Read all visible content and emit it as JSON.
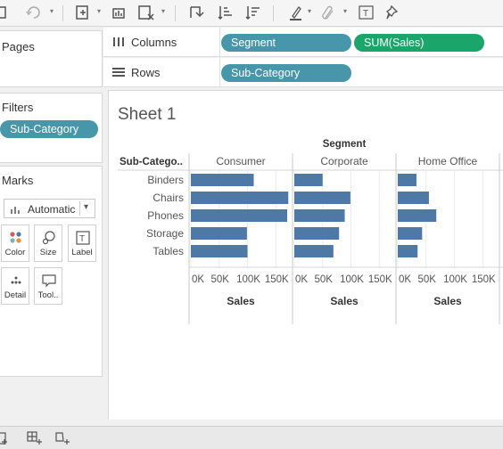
{
  "toolbar": {
    "icons": [
      "new-worksheet-icon",
      "refresh-icon",
      "new-datasource-icon",
      "clear-sheet-icon",
      "swap-icon",
      "sort-ascending-icon",
      "sort-descending-icon",
      "highlight-icon",
      "group-icon",
      "label-icon",
      "pin-icon"
    ]
  },
  "cards": {
    "pages": "Pages",
    "filters": "Filters",
    "filter_pill": "Sub-Category",
    "marks": "Marks",
    "mark_type": "Automatic",
    "mark_buttons": [
      "Color",
      "Size",
      "Label",
      "Detail",
      "Tool.."
    ]
  },
  "shelves": {
    "columns_label": "Columns",
    "rows_label": "Rows",
    "columns_pills": [
      "Segment",
      "SUM(Sales)"
    ],
    "rows_pills": [
      "Sub-Category"
    ]
  },
  "sheet": {
    "title": "Sheet 1",
    "segment_header": "Segment",
    "row_header": "Sub-Catego..",
    "axis_label": "Sales"
  },
  "colors": {
    "bar": "#4e79a7",
    "dimension_pill": "#4896a9",
    "measure_pill": "#1aa56a"
  },
  "chart_data": {
    "type": "bar",
    "title": "Sheet 1",
    "xlabel": "Sales",
    "ylabel": "Sub-Catego..",
    "categories": [
      "Binders",
      "Chairs",
      "Phones",
      "Storage",
      "Tables"
    ],
    "panel_field": "Segment",
    "x_ticks": [
      "0K",
      "50K",
      "100K",
      "150K"
    ],
    "xlim": [
      0,
      170000
    ],
    "grid": true,
    "series": [
      {
        "name": "Consumer",
        "values": [
          111000,
          172000,
          170000,
          99000,
          100000
        ]
      },
      {
        "name": "Corporate",
        "values": [
          50000,
          99000,
          89000,
          79000,
          69000
        ]
      },
      {
        "name": "Home Office",
        "values": [
          33000,
          55000,
          68000,
          43000,
          35000
        ]
      }
    ]
  }
}
